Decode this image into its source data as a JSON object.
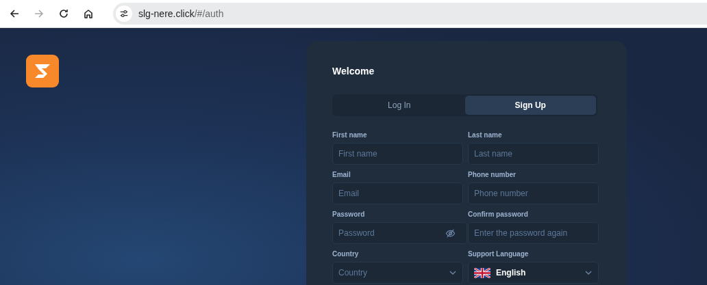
{
  "browser": {
    "url_host": "slg-nere.click",
    "url_path": "/#/auth"
  },
  "form": {
    "title": "Welcome",
    "tabs": [
      {
        "label": "Log In",
        "selected": false
      },
      {
        "label": "Sign Up",
        "selected": true
      }
    ],
    "fields": [
      {
        "kind": "text",
        "label": "First name",
        "placeholder": "First name"
      },
      {
        "kind": "text",
        "label": "Last name",
        "placeholder": "Last name"
      },
      {
        "kind": "text",
        "label": "Email",
        "placeholder": "Email"
      },
      {
        "kind": "text",
        "label": "Phone number",
        "placeholder": "Phone number"
      },
      {
        "kind": "password",
        "label": "Password",
        "placeholder": "Password"
      },
      {
        "kind": "text",
        "label": "Confirm password",
        "placeholder": "Enter the password again"
      },
      {
        "kind": "select",
        "label": "Country",
        "placeholder": "Country"
      },
      {
        "kind": "language",
        "label": "Support Language",
        "value": "English"
      }
    ]
  }
}
